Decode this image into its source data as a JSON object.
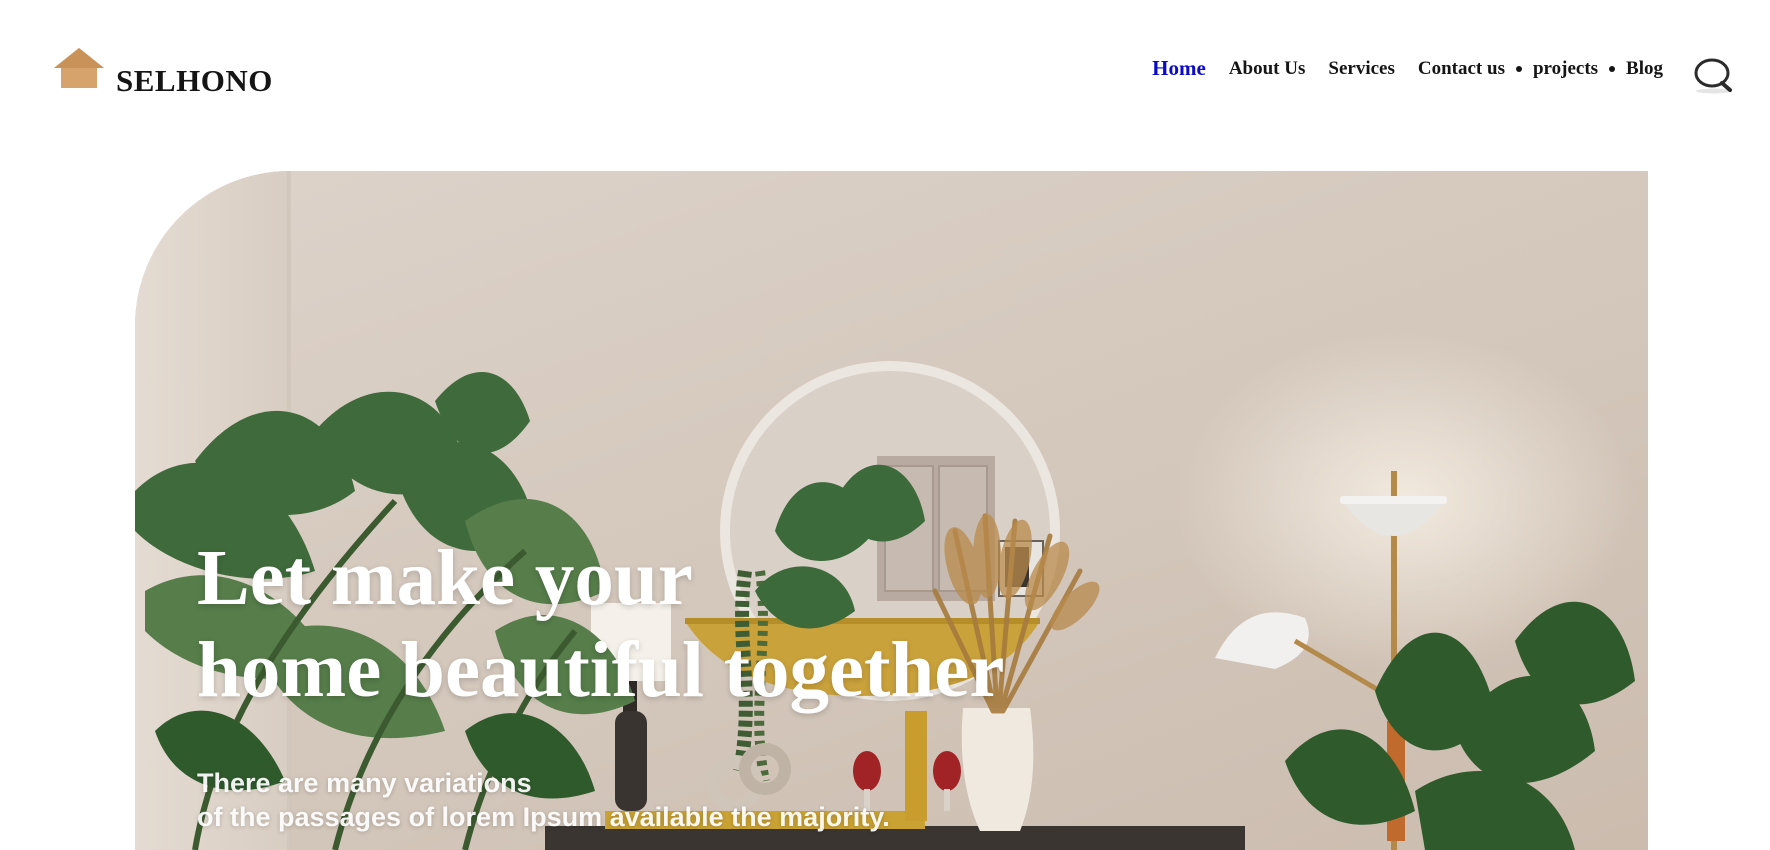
{
  "brand": {
    "name": "SELHONO",
    "logo_icon": "house-icon",
    "logo_color": "#d7a36c"
  },
  "nav": {
    "items": [
      {
        "label": "Home",
        "active": true
      },
      {
        "label": "About Us",
        "active": false
      },
      {
        "label": "Services",
        "active": false
      },
      {
        "label": "Contact us",
        "active": false
      },
      {
        "label": "projects",
        "active": false
      },
      {
        "label": "Blog",
        "active": false
      }
    ],
    "active_color": "#0a0acd",
    "search_icon": "search-icon"
  },
  "hero": {
    "title_line1": "Let make your",
    "title_line2": "home beautiful together",
    "subtitle_line1": "There are many variations",
    "subtitle_line2": "of the passages of lorem Ipsum available the majority."
  }
}
